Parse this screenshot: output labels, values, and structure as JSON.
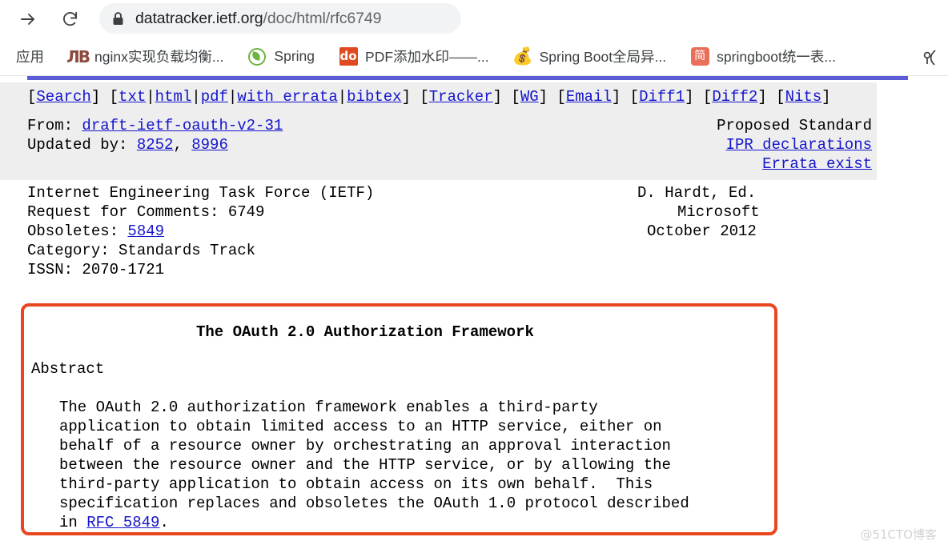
{
  "browser": {
    "forward_icon": "forward-arrow-icon",
    "reload_icon": "reload-icon",
    "lock_icon": "lock-icon",
    "url_host": "datatracker.ietf.org",
    "url_path": "/doc/html/rfc6749",
    "url_full": "datatracker.ietf.org/doc/html/rfc6749",
    "bookmarks_label": "应用",
    "bookmarks": [
      {
        "icon": "jb-favicon",
        "label": "nginx实现负载均衡..."
      },
      {
        "icon": "spring-leaf-favicon",
        "label": "Spring"
      },
      {
        "icon": "do-favicon",
        "label": "PDF添加水印——..."
      },
      {
        "icon": "money-bag-favicon",
        "label": "Spring Boot全局异..."
      },
      {
        "icon": "jianshu-favicon",
        "label": "springboot统一表..."
      }
    ],
    "overflow_icon": "bookmarks-overflow-icon"
  },
  "doc": {
    "nav_links": {
      "group1": [
        "Search"
      ],
      "group2": [
        "txt",
        "html",
        "pdf",
        "with errata",
        "bibtex"
      ],
      "group3": [
        "Tracker"
      ],
      "group4": [
        "WG"
      ],
      "group5": [
        "Email"
      ],
      "group6": [
        "Diff1"
      ],
      "group7": [
        "Diff2"
      ],
      "group8": [
        "Nits"
      ]
    },
    "from_label": "From: ",
    "from_value": "draft-ietf-oauth-v2-31",
    "updated_label": "Updated by: ",
    "updated_values": [
      "8252",
      "8996"
    ],
    "status": "Proposed Standard",
    "ipr_link": "IPR declarations",
    "errata_link": "Errata exist",
    "header_left": [
      "Internet Engineering Task Force (IETF)",
      "Request for Comments: 6749",
      "Obsoletes: ",
      "Category: Standards Track",
      "ISSN: 2070-1721"
    ],
    "obsoletes_value": "5849",
    "header_right": [
      "D. Hardt, Ed.",
      "Microsoft",
      "October 2012"
    ],
    "title": "The OAuth 2.0 Authorization Framework",
    "abstract_heading": "Abstract",
    "abstract_lines": [
      "The OAuth 2.0 authorization framework enables a third-party",
      "application to obtain limited access to an HTTP service, either on",
      "behalf of a resource owner by orchestrating an approval interaction",
      "between the resource owner and the HTTP service, or by allowing the",
      "third-party application to obtain access on its own behalf.  This",
      "specification replaces and obsoletes the OAuth 1.0 protocol described",
      "in "
    ],
    "abstract_link": "RFC 5849",
    "abstract_tail": ".",
    "highlight_color": "#e8461f"
  },
  "watermark": "@51CTO博客"
}
